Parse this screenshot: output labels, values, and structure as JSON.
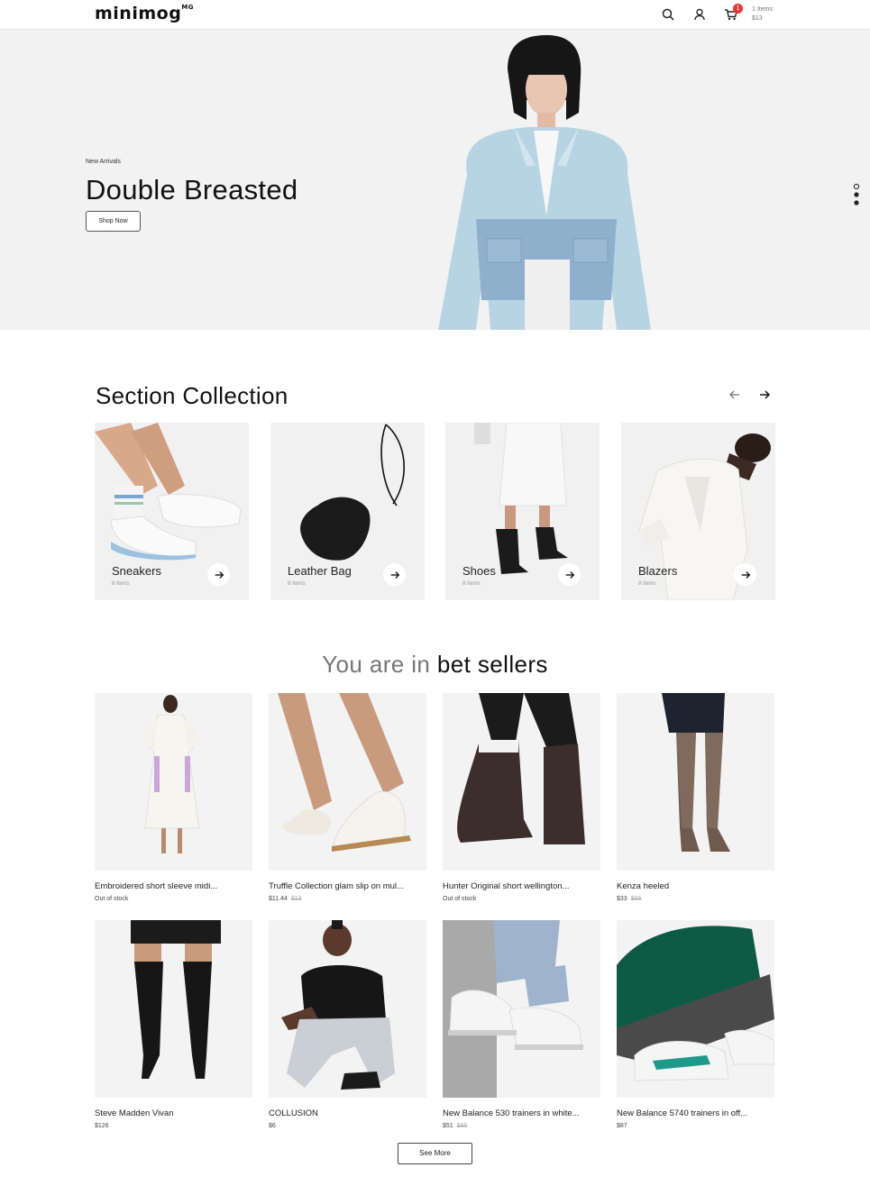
{
  "header": {
    "logo": "minimog",
    "logo_sup": "MG",
    "cart_badge": "1",
    "cart_items": "1 Items",
    "cart_total": "$13"
  },
  "hero": {
    "kicker": "New Arrivals",
    "title": "Double Breasted",
    "button": "Shop Now"
  },
  "collection": {
    "title": "Section Collection",
    "cards": [
      {
        "label": "Sneakers",
        "count": "8 Items"
      },
      {
        "label": "Leather Bag",
        "count": "8 Items"
      },
      {
        "label": "Shoes",
        "count": "8 Items"
      },
      {
        "label": "Blazers",
        "count": "8 Items"
      }
    ]
  },
  "bestsellers": {
    "prefix": "You are in ",
    "emphasis": "bet sellers",
    "products": [
      {
        "name": "Embroidered short sleeve midi...",
        "price": "Out of stock",
        "old": ""
      },
      {
        "name": "Truffle Collection glam slip on mul...",
        "price": "$11.44",
        "old": "$13"
      },
      {
        "name": "Hunter Original short wellington...",
        "price": "Out of stock",
        "old": ""
      },
      {
        "name": "Kenza heeled",
        "price": "$33",
        "old": "$66"
      },
      {
        "name": "Steve Madden Vivan",
        "price": "$126",
        "old": ""
      },
      {
        "name": "COLLUSION",
        "price": "$6",
        "old": ""
      },
      {
        "name": "New Balance 530 trainers in white...",
        "price": "$51",
        "old": "$85"
      },
      {
        "name": "New Balance 5740 trainers in off...",
        "price": "$87",
        "old": ""
      }
    ],
    "see_more": "See More"
  },
  "colors": {
    "accent": "#111111",
    "badge": "#e53935",
    "hero_bg": "#f2f2f2"
  }
}
